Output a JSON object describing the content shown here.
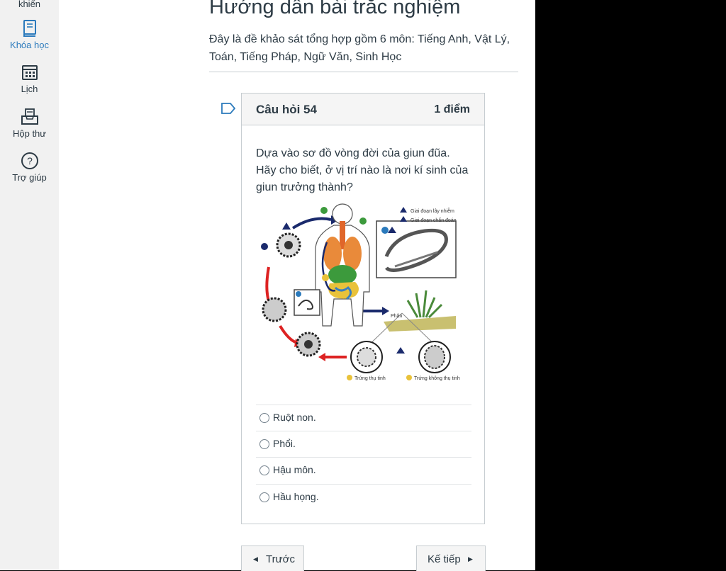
{
  "sidebar": {
    "items": [
      {
        "label": "khiển",
        "icon": "dashboard-icon"
      },
      {
        "label": "Khóa học",
        "icon": "courses-icon",
        "active": true
      },
      {
        "label": "Lịch",
        "icon": "calendar-icon"
      },
      {
        "label": "Hộp thư",
        "icon": "inbox-icon"
      },
      {
        "label": "Trợ giúp",
        "icon": "help-icon"
      }
    ],
    "active_color": "#2b7abc"
  },
  "page": {
    "title": "Hướng dẫn bài trắc nghiệm",
    "intro": "Đây là đề khảo sát tổng hợp gồm 6 môn: Tiếng Anh, Vật Lý, Toán, Tiếng Pháp, Ngữ Văn, Sinh Học"
  },
  "question": {
    "title": "Câu hỏi 54",
    "points": "1 điểm",
    "text": "Dựa vào sơ đồ vòng đời của giun đũa. Hãy cho biết, ở vị trí nào là nơi kí sinh của giun trưởng thành?",
    "diagram": {
      "legend": [
        "Giai đoạn lây nhiễm",
        "Giai đoạn chẩn đoán"
      ],
      "feces_label": "Phân",
      "egg_labels": [
        "Trứng thụ tinh",
        "Trứng không thụ tinh"
      ]
    },
    "answers": [
      "Ruột non.",
      "Phổi.",
      "Hậu môn.",
      "Hầu họng."
    ]
  },
  "nav": {
    "prev_label": "Trước",
    "next_label": "Kế tiếp"
  }
}
